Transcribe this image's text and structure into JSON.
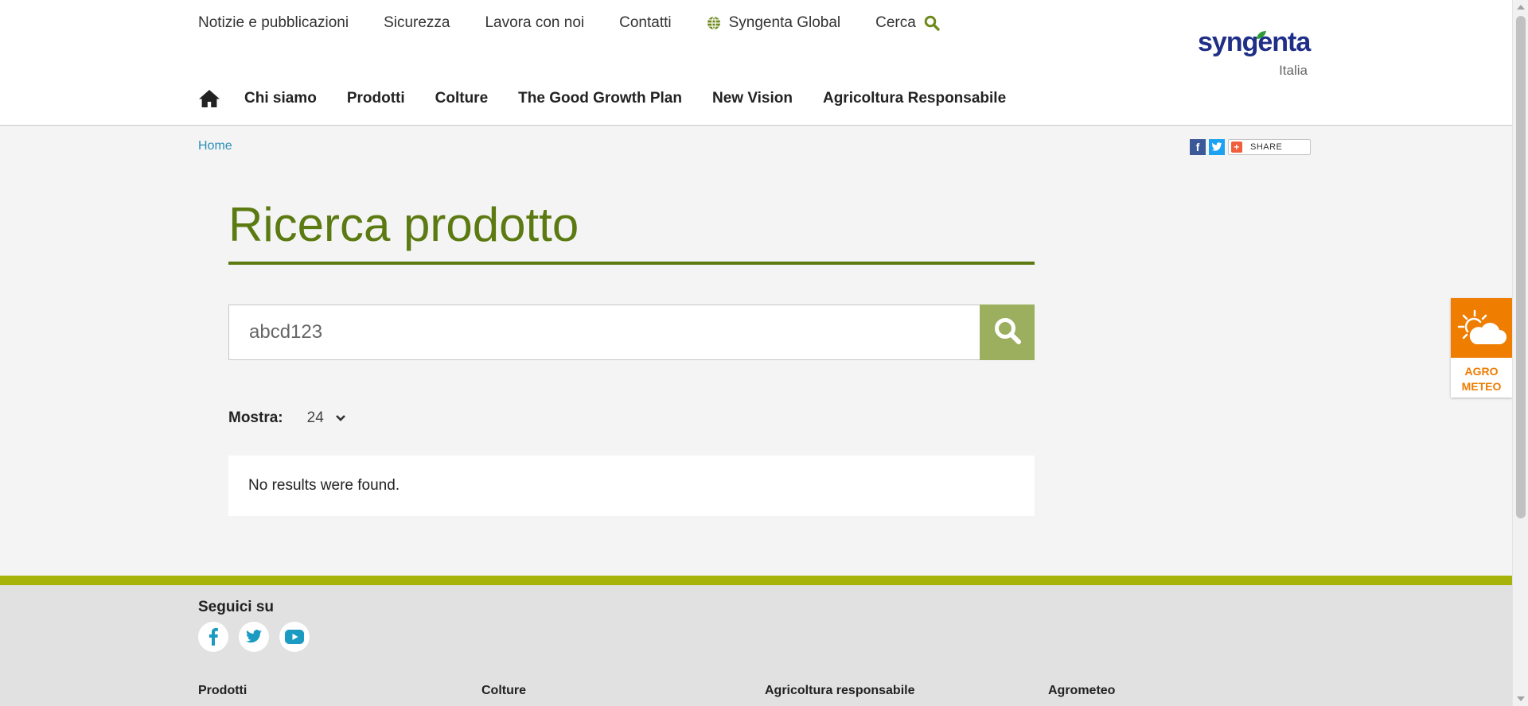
{
  "header": {
    "utility_links": [
      {
        "label": "Notizie e pubblicazioni"
      },
      {
        "label": "Sicurezza"
      },
      {
        "label": "Lavora con noi"
      },
      {
        "label": "Contatti"
      },
      {
        "label": "Syngenta Global",
        "icon": "globe-icon"
      }
    ],
    "search_label": "Cerca",
    "logo": {
      "brand": "syngenta",
      "country": "Italia"
    },
    "main_nav": [
      {
        "label": "Chi siamo"
      },
      {
        "label": "Prodotti"
      },
      {
        "label": "Colture"
      },
      {
        "label": "The Good Growth Plan"
      },
      {
        "label": "New Vision"
      },
      {
        "label": "Agricoltura Responsabile"
      }
    ]
  },
  "breadcrumb": {
    "home": "Home"
  },
  "share": {
    "facebook": "f",
    "twitter": "t",
    "share_label": "SHARE"
  },
  "main": {
    "title": "Ricerca prodotto",
    "search_value": "abcd123",
    "show_label": "Mostra:",
    "show_value": "24",
    "no_results": "No results were found."
  },
  "agrometeo_widget": {
    "line1": "AGRO",
    "line2": "METEO"
  },
  "footer": {
    "follow_label": "Seguici su",
    "social_icons": [
      "facebook-icon",
      "twitter-icon",
      "youtube-icon"
    ],
    "columns": [
      "Prodotti",
      "Colture",
      "Agricoltura responsabile",
      "Agrometeo"
    ]
  },
  "colors": {
    "brand_green": "#5c7a12",
    "search_button": "#9caf5e",
    "footer_stripe": "#a7b20b",
    "agrometeo_orange": "#ee7d00",
    "link_blue": "#2a8fb7",
    "logo_blue": "#1f2f88"
  }
}
